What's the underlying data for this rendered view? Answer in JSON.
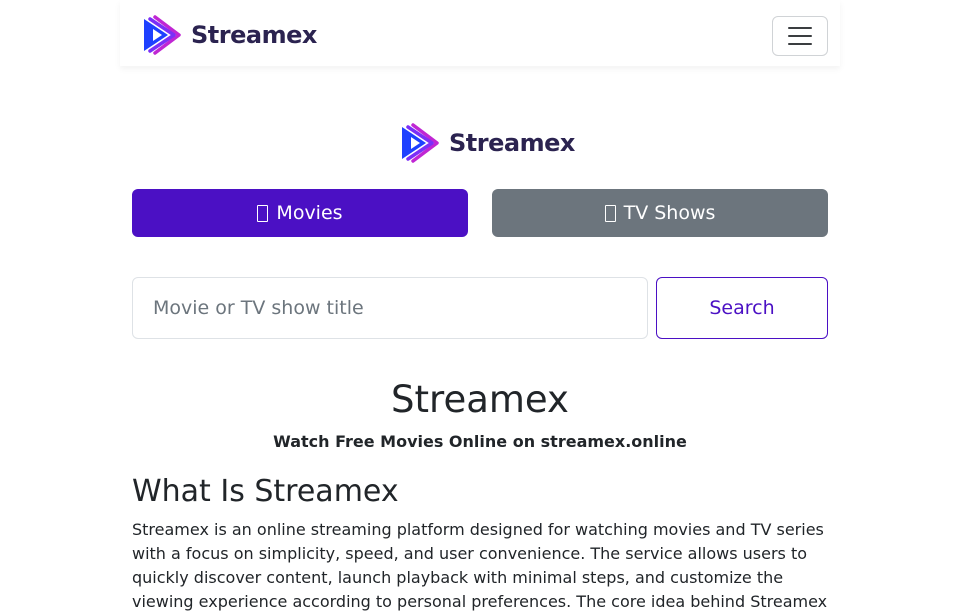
{
  "brand": {
    "name": "Streamex",
    "colors": {
      "dark": "#2b2350",
      "blue": "#1e40ff",
      "purple": "#7b2ff7",
      "magenta": "#c026d3",
      "accent": "#4b10c4",
      "secondary": "#6c757d"
    }
  },
  "navbar": {
    "logo_icon": "play-triangle-icon",
    "toggler_icon": "hamburger-menu-icon"
  },
  "content_type": {
    "movies_label": "Movies",
    "tv_label": "TV Shows",
    "movies_icon": "missing-glyph-icon",
    "tv_icon": "missing-glyph-icon"
  },
  "search": {
    "value": "",
    "placeholder": "Movie or TV show title",
    "button_label": "Search"
  },
  "hero": {
    "title": "Streamex",
    "tagline": "Watch Free Movies Online on streamex.online"
  },
  "about": {
    "heading": "What Is Streamex",
    "body": "Streamex is an online streaming platform designed for watching movies and TV series with a focus on simplicity, speed, and user convenience. The service allows users to quickly discover content, launch playback with minimal steps, and customize the viewing experience according to personal preferences. The core idea behind Streamex"
  }
}
